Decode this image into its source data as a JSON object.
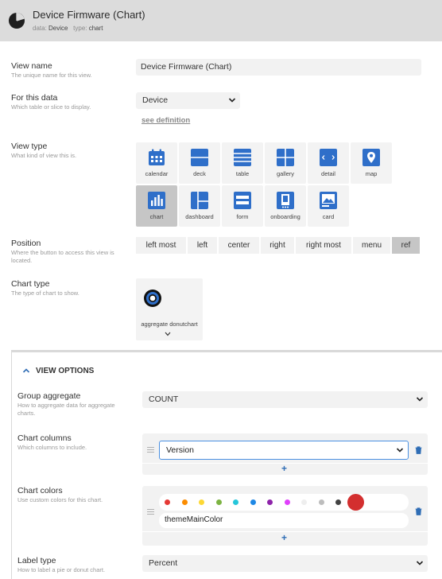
{
  "header": {
    "title": "Device Firmware (Chart)",
    "data_label": "data:",
    "data_value": "Device",
    "type_label": "type:",
    "type_value": "chart",
    "icon": "pie-chart-icon"
  },
  "view_name": {
    "label": "View name",
    "hint": "The unique name for this view.",
    "value": "Device Firmware (Chart)"
  },
  "for_this_data": {
    "label": "For this data",
    "hint": "Which table or slice to display.",
    "value": "Device",
    "link": "see definition"
  },
  "view_type": {
    "label": "View type",
    "hint": "What kind of view this is.",
    "selected": "chart",
    "items": [
      {
        "label": "calendar",
        "icon": "calendar-icon"
      },
      {
        "label": "deck",
        "icon": "deck-icon"
      },
      {
        "label": "table",
        "icon": "table-icon"
      },
      {
        "label": "gallery",
        "icon": "gallery-icon"
      },
      {
        "label": "detail",
        "icon": "detail-icon"
      },
      {
        "label": "map",
        "icon": "map-icon"
      },
      {
        "label": "chart",
        "icon": "chart-icon"
      },
      {
        "label": "dashboard",
        "icon": "dashboard-icon"
      },
      {
        "label": "form",
        "icon": "form-icon"
      },
      {
        "label": "onboarding",
        "icon": "onboarding-icon"
      },
      {
        "label": "card",
        "icon": "card-icon"
      }
    ]
  },
  "position": {
    "label": "Position",
    "hint_line1": "Where the button to access this view is",
    "hint_line2": "located.",
    "selected": "ref",
    "options": [
      "left most",
      "left",
      "center",
      "right",
      "right most",
      "menu",
      "ref"
    ]
  },
  "chart_type": {
    "label": "Chart type",
    "hint": "The type of chart to show.",
    "value": "aggregate donutchart",
    "icon": "donut-chart-icon"
  },
  "view_options": {
    "title": "VIEW OPTIONS",
    "group_aggregate": {
      "label": "Group aggregate",
      "hint_line1": "How to aggregate data for aggregate",
      "hint_line2": "charts.",
      "value": "COUNT"
    },
    "chart_columns": {
      "label": "Chart columns",
      "hint": "Which columns to include.",
      "value": "Version",
      "add": "+"
    },
    "chart_colors": {
      "label": "Chart colors",
      "hint": "Use custom colors for this chart.",
      "value": "themeMainColor",
      "add": "+",
      "palette": [
        "#e53935",
        "#fb8c00",
        "#fdd835",
        "#7cb342",
        "#26c6da",
        "#1e88e5",
        "#8e24aa",
        "#e040fb",
        "#eeeeee",
        "#bdbdbd",
        "#424242",
        "#d32f2f"
      ]
    },
    "label_type": {
      "label": "Label type",
      "hint": "How to label a pie or donut chart.",
      "value": "Percent"
    }
  }
}
